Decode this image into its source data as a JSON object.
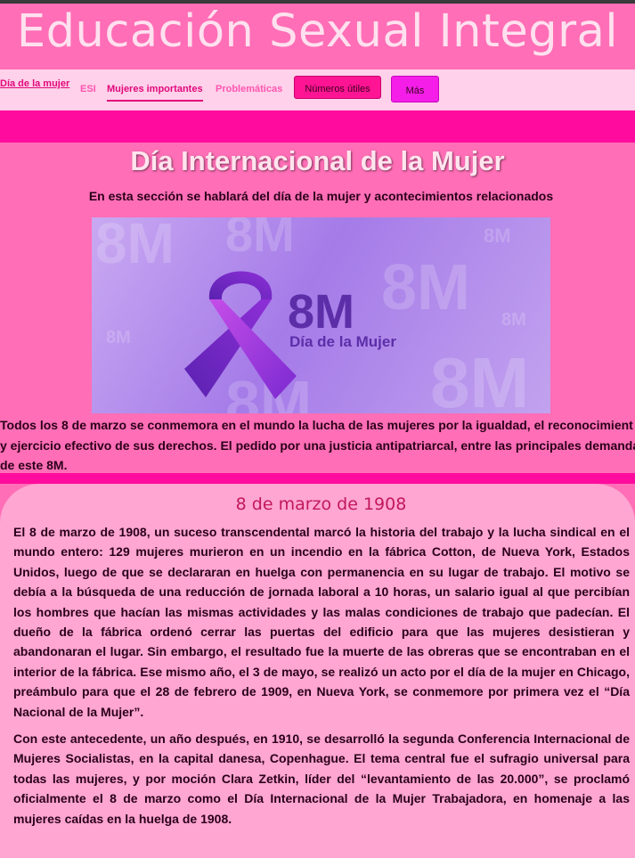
{
  "site": {
    "title": "Educación Sexual Integral"
  },
  "nav": {
    "links": [
      "Día de la mujer",
      "ESI",
      "Mujeres importantes",
      "Problemáticas"
    ],
    "buttons": [
      "Números útiles",
      "Más info"
    ]
  },
  "hero": {
    "title": "Día Internacional de la Mujer",
    "subtitle": "En esta sección se hablará del día de la mujer y acontecimientos relacionados"
  },
  "banner": {
    "big_text": "8M",
    "caption": "Día de la Mujer",
    "watermark": "8M"
  },
  "intro": {
    "lines": [
      "Todos los 8 de marzo se conmemora en el mundo la lucha de las mujeres por la igualdad, el reconocimient",
      "y ejercicio efectivo de sus derechos. El pedido por una justicia antipatriarcal, entre las principales demanda",
      "de este 8M."
    ]
  },
  "section": {
    "title": "8 de marzo de 1908",
    "paragraphs": [
      "El 8 de marzo de 1908, un suceso transcendental marcó la historia del trabajo y la lucha sindical en el mundo entero: 129 mujeres murieron en un incendio en la fábrica Cotton, de Nueva York, Estados Unidos, luego de que se declararan en huelga con permanencia en su lugar de trabajo. El motivo se debía a la búsqueda de una reducción de jornada laboral a 10 horas, un salario igual al que percibían los hombres que hacían las mismas actividades y las malas condiciones de trabajo que padecían. El dueño de la fábrica ordenó cerrar las puertas del edificio para que las mujeres desistieran y abandonaran el lugar. Sin embargo, el resultado fue la muerte de las obreras que se encontraban en el interior de la fábrica. Ese mismo año, el 3 de mayo, se realizó un acto por el día de la mujer en Chicago, preámbulo para que el 28 de febrero de 1909, en Nueva York, se conmemore por primera vez el “Día Nacional de la Mujer”.",
      "Con este antecedente, un año después, en 1910, se desarrolló la segunda Conferencia Internacional de Mujeres Socialistas, en la capital danesa, Copenhague. El tema central fue el sufragio universal para todas las mujeres, y por moción Clara Zetkin, líder del “levantamiento de las 20.000”, se proclamó oficialmente el 8 de marzo como el Día Internacional de la Mujer Trabajadora, en homenaje a las mujeres caídas en la huelga de 1908."
    ]
  },
  "colors": {
    "page_bg": "#ff6eb6",
    "nav_bg": "#ffd1ea",
    "accent": "#ff0c9e",
    "card_bg": "#ffa6d2",
    "ribbon": "#9b3ee0"
  }
}
